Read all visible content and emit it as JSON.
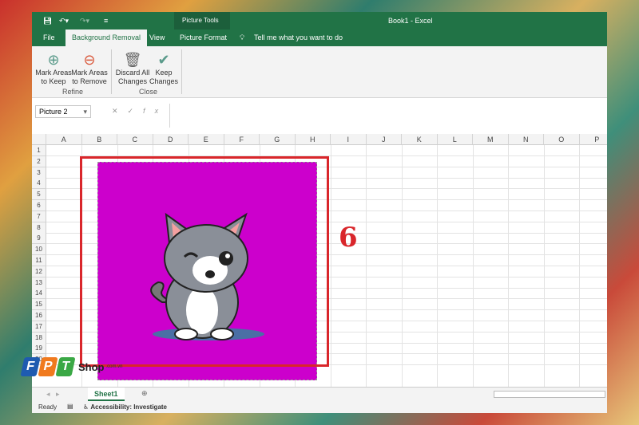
{
  "title": {
    "app": "Book1 - Excel",
    "context": "Picture Tools"
  },
  "tabs": [
    "File",
    "Background Removal",
    "View",
    "Picture Format"
  ],
  "tell_me": "Tell me what you want to do",
  "ribbon": {
    "buttons": [
      {
        "l1": "Mark Areas",
        "l2": "to Keep"
      },
      {
        "l1": "Mark Areas",
        "l2": "to Remove"
      },
      {
        "l1": "Discard All",
        "l2": "Changes"
      },
      {
        "l1": "Keep",
        "l2": "Changes"
      }
    ],
    "groups": [
      "Refine",
      "Close"
    ]
  },
  "namebox": "Picture 2",
  "fx": "fx",
  "columns": [
    "A",
    "B",
    "C",
    "D",
    "E",
    "F",
    "G",
    "H",
    "I",
    "J",
    "K",
    "L",
    "M",
    "N",
    "O",
    "P"
  ],
  "rows": [
    "1",
    "2",
    "3",
    "4",
    "5",
    "6",
    "7",
    "8",
    "9",
    "10",
    "11",
    "12",
    "13",
    "14",
    "15",
    "16",
    "17",
    "18",
    "19",
    "20"
  ],
  "annotation": "6",
  "sheet_tab": "Sheet1",
  "status": {
    "ready": "Ready",
    "accessibility": "Accessibility: Investigate"
  },
  "logo": {
    "letters": [
      "F",
      "P",
      "T"
    ],
    "shop": "Shop",
    ".com.vn": ".com.vn"
  }
}
